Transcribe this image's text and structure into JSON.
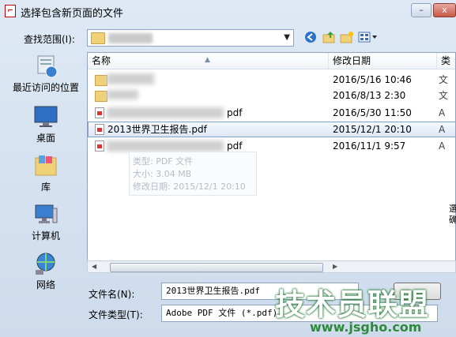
{
  "window": {
    "title": "选择包含新页面的文件",
    "title_icon": "pdf-file-icon",
    "controls": {
      "minimize": "–",
      "close": "x"
    }
  },
  "lookin": {
    "label": "查找范围(I):",
    "value": ""
  },
  "places": [
    {
      "label": "最近访问的位置",
      "icon": "recent-places-icon"
    },
    {
      "label": "桌面",
      "icon": "desktop-icon"
    },
    {
      "label": "库",
      "icon": "libraries-icon"
    },
    {
      "label": "计算机",
      "icon": "computer-icon"
    },
    {
      "label": "网络",
      "icon": "network-icon"
    }
  ],
  "columns": {
    "name": "名称",
    "date": "修改日期",
    "third": "类"
  },
  "rows": [
    {
      "name": "",
      "date": "2016/5/16 10:46",
      "third": "文",
      "type": "folder"
    },
    {
      "name": "",
      "date": "2016/8/13 2:30",
      "third": "文",
      "type": "folder"
    },
    {
      "name": "pdf",
      "date": "2016/5/30 11:50",
      "third": "A",
      "type": "pdf"
    },
    {
      "name": "2013世界卫生报告.pdf",
      "date": "2015/12/1 20:10",
      "third": "A",
      "type": "pdf",
      "selected": true
    },
    {
      "name": "pdf",
      "date": "2016/11/1 9:57",
      "third": "A",
      "type": "pdf"
    }
  ],
  "tooltip": {
    "type": "类型: PDF 文件",
    "size": "大小: 3.04 MB",
    "modified": "修改日期: 2015/12/1 20:10"
  },
  "filename": {
    "label": "文件名(N):",
    "value": "2013世界卫生报告.pdf"
  },
  "filetype": {
    "label": "文件类型(T):",
    "value": "Adobe PDF 文件 (*.pdf)"
  },
  "side_chars": "選 确",
  "watermark": {
    "main": "技术员联盟",
    "url": "www.jsgho.com"
  },
  "colors": {
    "selection_border": "#7da2ce",
    "watermark_green": "#2e8a3a"
  }
}
